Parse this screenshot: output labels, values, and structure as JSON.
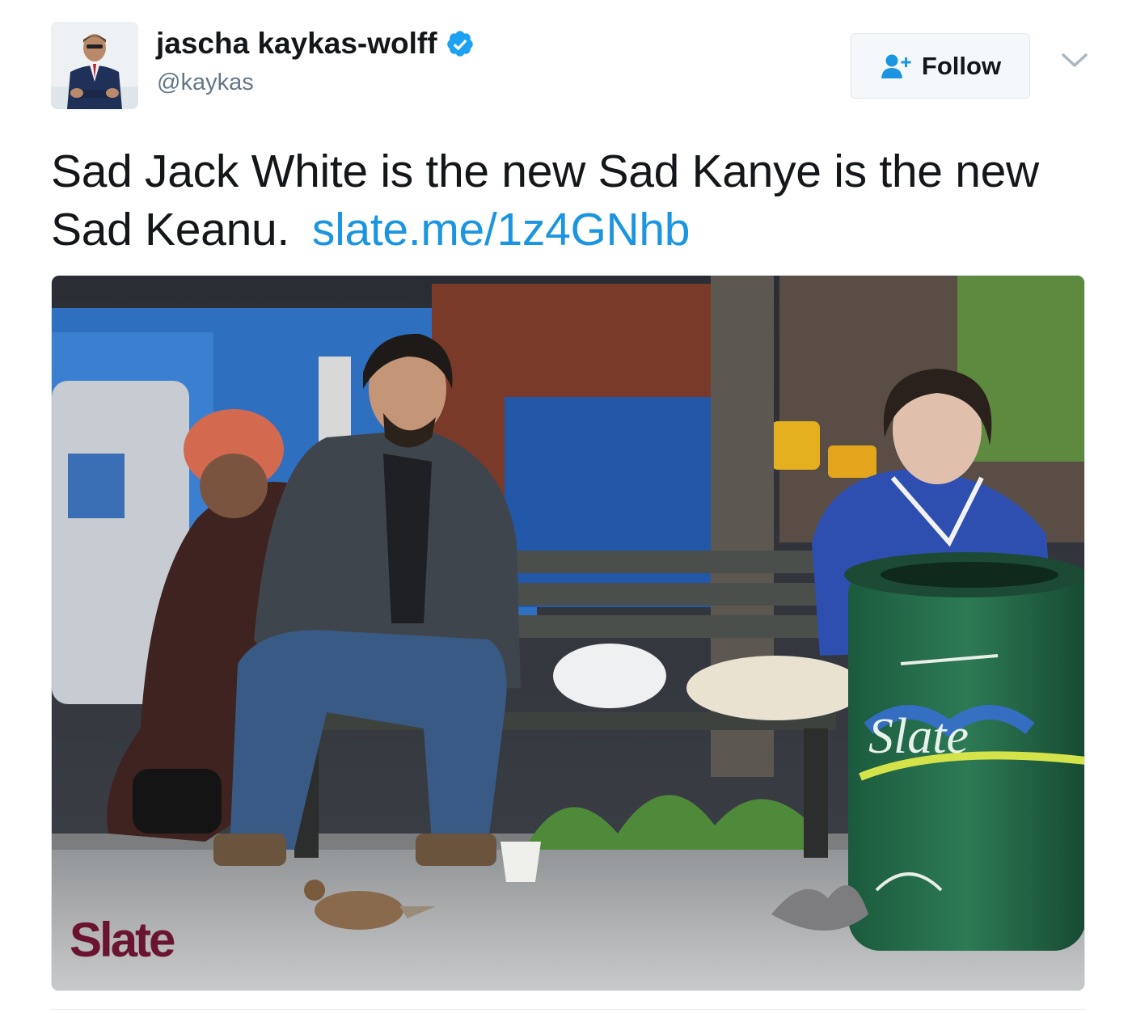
{
  "author": {
    "display_name": "jascha kaykas-wolff",
    "handle": "@kaykas",
    "verified": true,
    "avatar_icon": "user-avatar"
  },
  "follow_button": {
    "label": "Follow",
    "icon": "add-user-icon"
  },
  "menu_icon": "chevron-down-icon",
  "tweet": {
    "text": "Sad Jack White is the new Sad Kanye is the new Sad Keanu.",
    "link": "slate.me/1z4GNhb"
  },
  "media": {
    "watermark": "Slate",
    "graffiti_text": "Slate"
  },
  "colors": {
    "link": "#1b95e0",
    "verified": "#1da1f2",
    "slate_brand": "#6a1430"
  }
}
